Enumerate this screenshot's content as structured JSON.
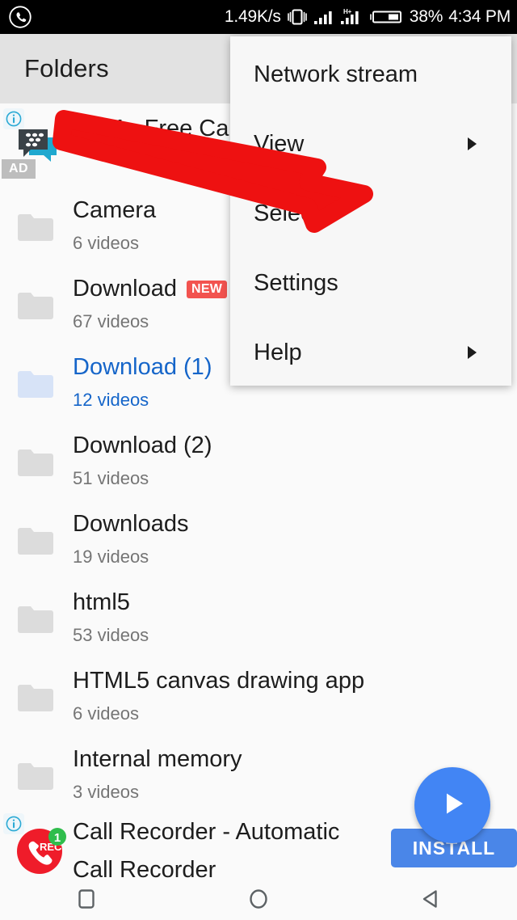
{
  "status_bar": {
    "left_icon": "whatsapp-icon",
    "network_speed": "1.49K/s",
    "icons": [
      "vibrate-icon",
      "signal-sim1-icon",
      "hsplus-icon",
      "signal-sim2-icon",
      "battery-icon"
    ],
    "battery_percent": "38%",
    "time": "4:34 PM"
  },
  "header": {
    "title": "Folders"
  },
  "top_ad": {
    "info_icon": "info-icon",
    "app_icon": "bbm-icon",
    "badge": "AD",
    "text": "BBM - Free Calls & Messages"
  },
  "folders": [
    {
      "name": "Camera",
      "count": "6 videos",
      "selected": false,
      "badge": ""
    },
    {
      "name": "Download",
      "count": "67 videos",
      "selected": false,
      "badge": "NEW"
    },
    {
      "name": "Download (1)",
      "count": "12 videos",
      "selected": true,
      "badge": ""
    },
    {
      "name": "Download (2)",
      "count": "51 videos",
      "selected": false,
      "badge": ""
    },
    {
      "name": "Downloads",
      "count": "19 videos",
      "selected": false,
      "badge": ""
    },
    {
      "name": "html5",
      "count": "53 videos",
      "selected": false,
      "badge": ""
    },
    {
      "name": "HTML5 canvas drawing app",
      "count": "6 videos",
      "selected": false,
      "badge": ""
    },
    {
      "name": "Internal memory",
      "count": "3 videos",
      "selected": false,
      "badge": ""
    }
  ],
  "bottom_ad": {
    "info_icon": "info-icon",
    "app_icon": "call-recorder-icon",
    "badge_count": "1",
    "text": "Call Recorder - Automatic Call Recorder",
    "install_label": "INSTALL"
  },
  "fab": {
    "icon": "play-icon"
  },
  "menu": {
    "items": [
      {
        "label": "Network stream",
        "has_submenu": false
      },
      {
        "label": "View",
        "has_submenu": true
      },
      {
        "label": "Select",
        "has_submenu": false
      },
      {
        "label": "Settings",
        "has_submenu": false
      },
      {
        "label": "Help",
        "has_submenu": true
      }
    ]
  },
  "annotation": {
    "shape": "red-arrow",
    "color": "#ee1111"
  },
  "nav_bar": {
    "buttons": [
      {
        "icon": "recents-square-icon"
      },
      {
        "icon": "home-circle-icon"
      },
      {
        "icon": "back-triangle-icon"
      }
    ]
  },
  "colors": {
    "accent_blue": "#4285f4",
    "selected_blue": "#1565c9",
    "install_blue": "#4a86e8",
    "new_badge_red": "#f2534f",
    "arrow_red": "#ee1111",
    "header_gray": "#e2e2e2"
  }
}
